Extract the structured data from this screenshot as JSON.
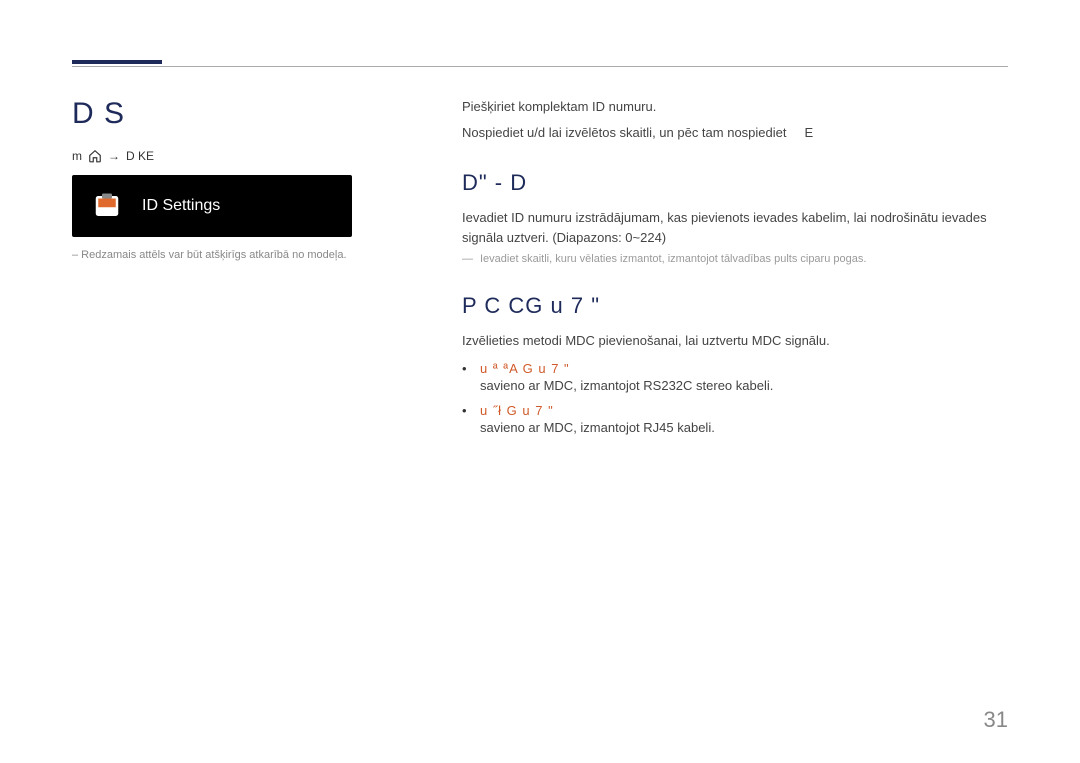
{
  "left": {
    "title": "D S",
    "nav": {
      "a": "m",
      "arrow": "→",
      "b": "D KE"
    },
    "card_label": "ID Settings",
    "footnote": "– Redzamais attēls var būt atšķirīgs atkarībā no modeļa."
  },
  "right": {
    "intro1": "Piešķiriet komplektam ID numuru.",
    "intro2_a": "Nospiediet ",
    "intro2_b": " lai izvēlētos skaitli, un pēc tam nospiediet",
    "intro2_c": "E",
    "sec1": {
      "heading": "D\"  -   D",
      "p1": "Ievadiet ID numuru izstrādājumam, kas pievienots ievades kabelim, lai nodrošinātu ievades signāla uztveri. (Diapazons: 0~224)",
      "note": "Ievadiet skaitli, kuru vēlaties izmantot, izmantojot tālvadības pults ciparu pogas."
    },
    "sec2": {
      "heading": "P  C              CG u 7 \"",
      "p1": "Izvēlieties metodi MDC pievienošanai, lai uztvertu MDC signālu.",
      "b1_label": "u  ª  ªA    G u 7 \"",
      "b1_text": "savieno ar MDC, izmantojot RS232C stereo kabeli.",
      "b2_label": "u   ˝ł    G u 7 \"",
      "b2_text": "savieno ar MDC, izmantojot RJ45 kabeli."
    }
  },
  "page_number": "31"
}
